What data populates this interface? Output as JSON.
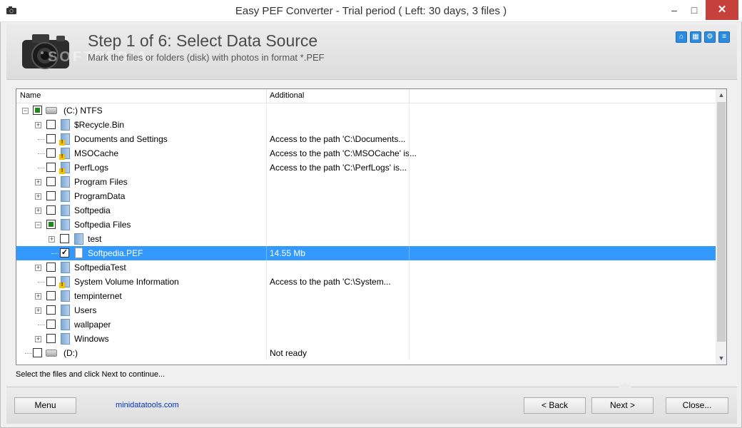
{
  "window": {
    "title": "Easy PEF Converter - Trial period ( Left: 30 days, 3 files )"
  },
  "header": {
    "step_title": "Step 1 of 6: Select Data Source",
    "step_subtitle": "Mark the files or folders (disk) with photos in format *.PEF",
    "watermark": "SOFTPEDIA",
    "icons": [
      "home-icon",
      "network-icon",
      "settings-icon",
      "about-icon"
    ]
  },
  "tree": {
    "columns": [
      "Name",
      "Additional"
    ],
    "rows": [
      {
        "name": "(C:) NTFS",
        "additional": ""
      },
      {
        "name": "$Recycle.Bin",
        "additional": ""
      },
      {
        "name": "Documents and Settings",
        "additional": "Access to the path 'C:\\Documents..."
      },
      {
        "name": "MSOCache",
        "additional": "Access to the path 'C:\\MSOCache' is..."
      },
      {
        "name": "PerfLogs",
        "additional": "Access to the path 'C:\\PerfLogs' is..."
      },
      {
        "name": "Program Files",
        "additional": ""
      },
      {
        "name": "ProgramData",
        "additional": ""
      },
      {
        "name": "Softpedia",
        "additional": ""
      },
      {
        "name": "Softpedia Files",
        "additional": ""
      },
      {
        "name": "test",
        "additional": ""
      },
      {
        "name": "Softpedia.PEF",
        "additional": "14.55 Mb"
      },
      {
        "name": "SoftpediaTest",
        "additional": ""
      },
      {
        "name": "System Volume Information",
        "additional": "Access to the path 'C:\\System..."
      },
      {
        "name": "tempinternet",
        "additional": ""
      },
      {
        "name": "Users",
        "additional": ""
      },
      {
        "name": "wallpaper",
        "additional": ""
      },
      {
        "name": "Windows",
        "additional": ""
      },
      {
        "name": "(D:)",
        "additional": "Not ready"
      }
    ]
  },
  "status_text": "Select the files and click Next to continue...",
  "footer": {
    "menu_label": "Menu",
    "link_text": "minidatatools.com",
    "back_label": "< Back",
    "next_label": "Next >",
    "close_label": "Close..."
  }
}
